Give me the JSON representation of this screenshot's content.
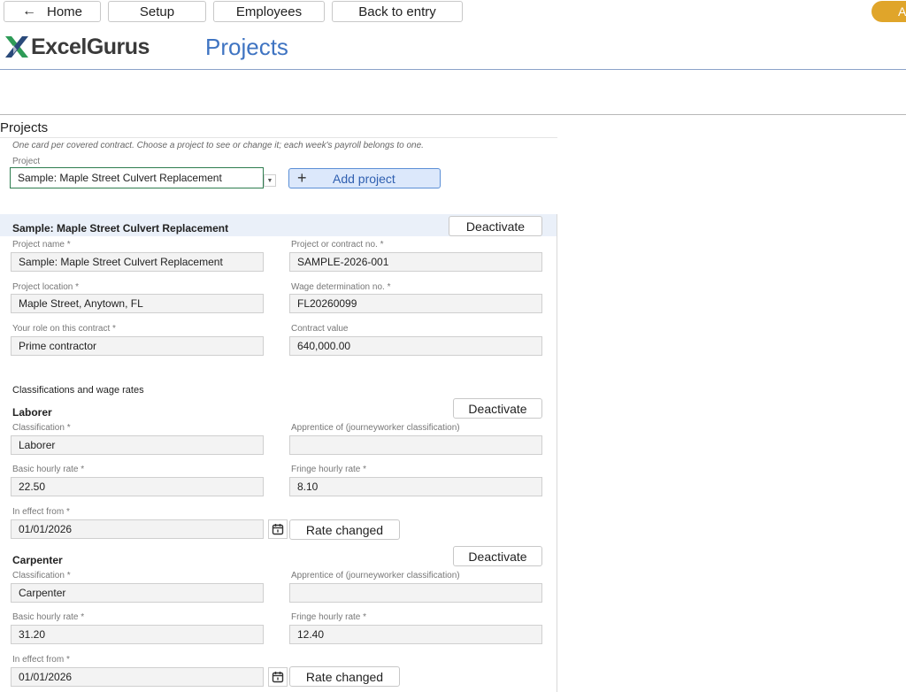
{
  "toolbar": {
    "home_label": "Home",
    "setup_label": "Setup",
    "employees_label": "Employees",
    "back_label": "Back to entry",
    "accent_label": "A"
  },
  "brand": {
    "name": "ExcelGurus"
  },
  "page": {
    "title": "Projects"
  },
  "projects_section": {
    "title": "Projects",
    "hint": "One card per covered contract. Choose a project to see or change it; each week's payroll belongs to one.",
    "project_label": "Project",
    "selected_project": "Sample: Maple Street Culvert Replacement",
    "add_project_label": "Add project"
  },
  "card": {
    "title": "Sample: Maple Street Culvert Replacement",
    "deactivate_label": "Deactivate",
    "fields": {
      "project_name_label": "Project name *",
      "project_name": "Sample: Maple Street Culvert Replacement",
      "contract_no_label": "Project or contract no. *",
      "contract_no": "SAMPLE-2026-001",
      "location_label": "Project location *",
      "location": "Maple Street, Anytown, FL",
      "wage_det_label": "Wage determination no. *",
      "wage_det": "FL20260099",
      "role_label": "Your role on this contract *",
      "role": "Prime contractor",
      "contract_value_label": "Contract value",
      "contract_value": "640,000.00"
    },
    "classifications_title": "Classifications and wage rates",
    "classifications": [
      {
        "title": "Laborer",
        "deactivate_label": "Deactivate",
        "classification_label": "Classification *",
        "classification": "Laborer",
        "apprentice_label": "Apprentice of (journeyworker classification)",
        "apprentice": "",
        "basic_label": "Basic hourly rate *",
        "basic": "22.50",
        "fringe_label": "Fringe hourly rate *",
        "fringe": "8.10",
        "effective_label": "In effect from *",
        "effective": "01/01/2026",
        "rate_changed_label": "Rate changed"
      },
      {
        "title": "Carpenter",
        "deactivate_label": "Deactivate",
        "classification_label": "Classification *",
        "classification": "Carpenter",
        "apprentice_label": "Apprentice of (journeyworker classification)",
        "apprentice": "",
        "basic_label": "Basic hourly rate *",
        "basic": "31.20",
        "fringe_label": "Fringe hourly rate *",
        "fringe": "12.40",
        "effective_label": "In effect from *",
        "effective": "01/01/2026",
        "rate_changed_label": "Rate changed"
      }
    ]
  },
  "colors": {
    "brand_blue": "#3f74c2",
    "accent_orange": "#e0a52a",
    "logo_green": "#2e9b57",
    "logo_navy": "#2a4a7a"
  },
  "icons": {
    "back": "arrow-left-icon",
    "logo": "excelgurus-x-logo",
    "dropdown": "chevron-down-icon",
    "add": "plus-icon",
    "calendar": "calendar-icon"
  }
}
